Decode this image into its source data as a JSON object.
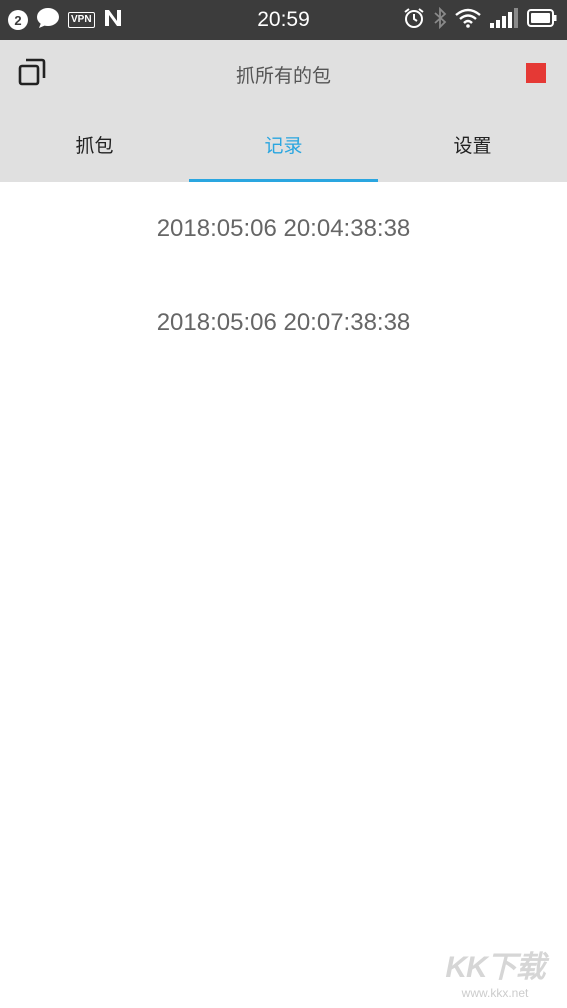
{
  "status_bar": {
    "notification_count": "2",
    "vpn_label": "VPN",
    "time": "20:59",
    "icons": [
      "notification-count-icon",
      "chat-bubble-icon",
      "vpn-icon",
      "n-app-icon",
      "alarm-icon",
      "bluetooth-icon",
      "wifi-icon",
      "signal-icon",
      "battery-icon"
    ]
  },
  "app_bar": {
    "title": "抓所有的包",
    "copy_icon": "copy-icon",
    "stop_icon": "stop-icon",
    "stop_color": "#e53935"
  },
  "tabs": [
    {
      "label": "抓包",
      "active": false
    },
    {
      "label": "记录",
      "active": true
    },
    {
      "label": "设置",
      "active": false
    }
  ],
  "accent_color": "#2aa6e0",
  "records": [
    {
      "timestamp": "2018:05:06 20:04:38:38"
    },
    {
      "timestamp": "2018:05:06 20:07:38:38"
    }
  ],
  "watermark": {
    "logo": "KK下载",
    "url": "www.kkx.net"
  }
}
